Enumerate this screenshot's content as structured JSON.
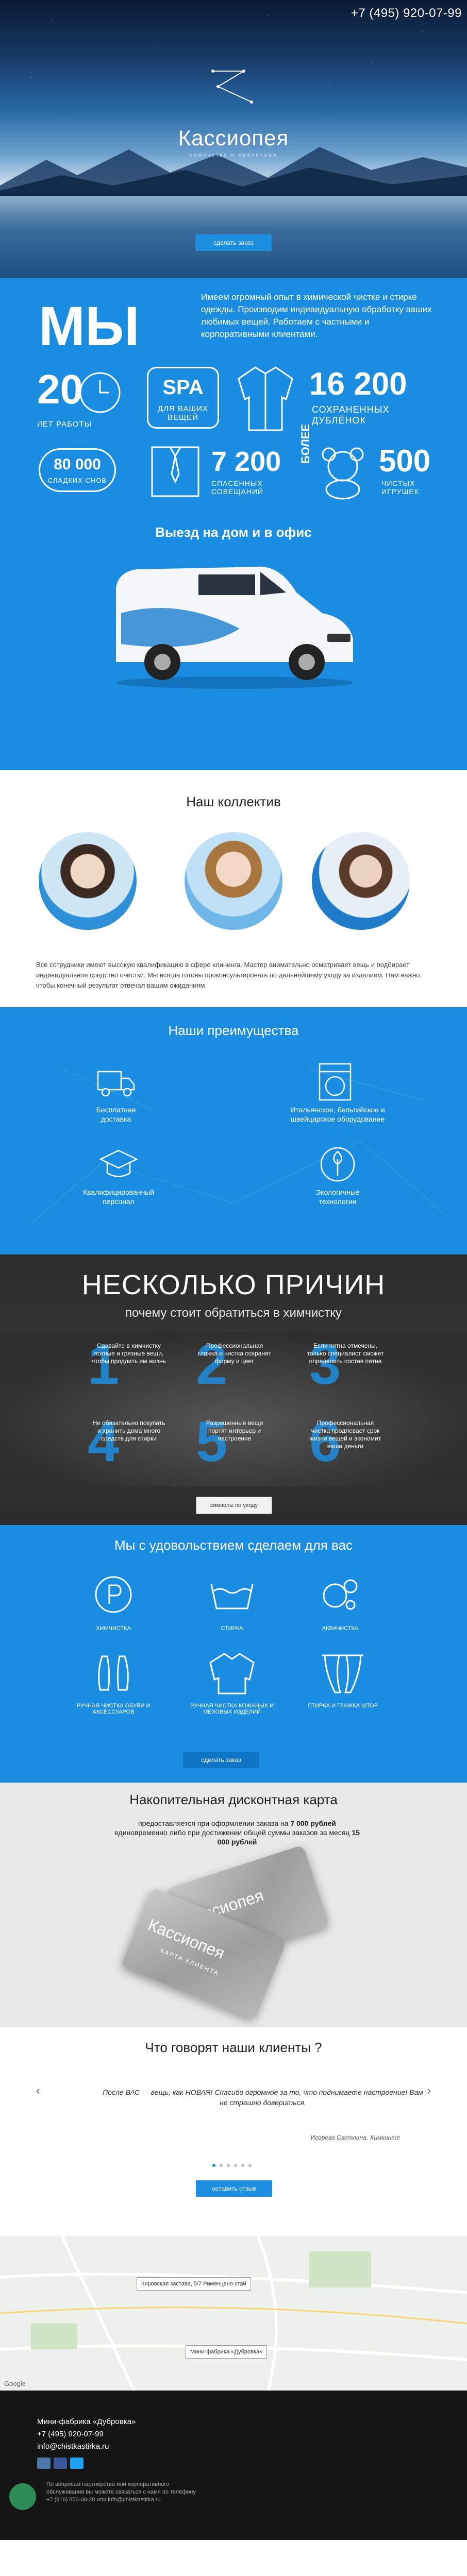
{
  "header": {
    "phone": "+7 (495) 920-07-99"
  },
  "hero": {
    "brand": "Кассиопея",
    "subtitle": "химчистка и прачечная",
    "cta": "сделать заказ"
  },
  "we": {
    "title": "МЫ",
    "about": "Имеем огромный опыт в химической чистке и стирке одежды. Производим индивидуальную обработку ваших любимых вещей. Работаем с частными и корпоративными клиентами.",
    "stats": [
      {
        "num": "20",
        "label": "ЛЕТ РАБОТЫ"
      },
      {
        "num": "SPA",
        "label": "ДЛЯ ВАШИХ ВЕЩЕЙ"
      },
      {
        "num": "16 200",
        "label": "СОХРАНЕННЫХ ДУБЛЁНОК"
      },
      {
        "num": "80 000",
        "label": "СЛАДКИХ СНОВ"
      },
      {
        "num": "7 200",
        "label": "СПАСЕННЫХ СОВЕЩАНИЙ"
      },
      {
        "num": "БОЛЕЕ",
        "label": ""
      },
      {
        "num": "500",
        "label": "ЧИСТЫХ ИГРУШЕК"
      }
    ],
    "delivery": "Выезд на дом и в офис"
  },
  "team": {
    "title": "Наш коллектив",
    "text": "Все сотрудники имеют высокую квалификацию в сфере клининга. Мастер внимательно осматривает вещь и подбирает индивидуальное средство очистки. Мы всегда готовы проконсультировать по дальнейшему уходу за изделием. Нам важно, чтобы конечный результат отвечал вашим ожиданиям."
  },
  "adv": {
    "title": "Наши преимущества",
    "items": [
      "Бесплатная доставка",
      "Итальянское, бельгийское и швейцарское оборудование",
      "Квалифицированный персонал",
      "Экологичные технологии"
    ]
  },
  "reasons": {
    "title": "НЕСКОЛЬКО ПРИЧИН",
    "sub": "почему стоит обратиться в химчистку",
    "items": [
      {
        "n": "1",
        "t": "Сдавайте в химчистку потные и грязные вещи, чтобы продлить им жизнь"
      },
      {
        "n": "2",
        "t": "Профессиональная глажка и чистка сохранят форму и цвет"
      },
      {
        "n": "3",
        "t": "Если пятна отмечены, только специалист сможет определить состав пятна"
      },
      {
        "n": "4",
        "t": "Не обязательно покупать и хранить дома много средств для стирки"
      },
      {
        "n": "5",
        "t": "Разрешенные вещи портят интерьер и настроение"
      },
      {
        "n": "6",
        "t": "Профессиональная чистка продлевает срок жизни вещей и экономит ваши деньги"
      }
    ],
    "btn": "символы по уходу"
  },
  "services": {
    "title": "Мы с удовольствием сделаем для вас",
    "items": [
      "ХИМЧИСТКА",
      "СТИРКА",
      "АКВАЧИСТКА",
      "РУЧНАЯ ЧИСТКА ОБУВИ И АКСЕССУАРОВ",
      "РУЧНАЯ ЧИСТКА КОЖАНЫХ И МЕХОВЫХ ИЗДЕЛИЙ",
      "СТИРКА И ГЛАЖКА ШТОР"
    ],
    "cta": "сделать заказ"
  },
  "card": {
    "title": "Накопительная дисконтная карта",
    "text1": "предоставляется при оформлении заказа на ",
    "sum1": "7 000 рублей",
    "text2": " единовременно либо при достижении общей суммы заказов за месяц ",
    "sum2": "15 000 рублей",
    "brand": "Кассиопея",
    "cardlabel": "КАРТА КЛИЕНТА"
  },
  "reviews": {
    "title": "Что говорят наши клиенты ?",
    "quote": "После ВАС — вещь, как НОВАЯ! Спасибо огромное за то, что поднимаете настроение! Вам не страшно довериться.",
    "author": "Игорева Светлана, Химкинте",
    "btn": "оставить отзыв"
  },
  "map": {
    "pin1": "Кировская застава, 5/7 Рименцено стай",
    "pin2": "Мини-фабрика «Дубровка»",
    "google": "Google"
  },
  "footer": {
    "addr": "Мини-фабрика «Дубровка»",
    "phone": "+7 (495) 920-07-99",
    "email": "info@chistkastirka.ru",
    "note": "По вопросам партнёрства или корпоративного обслуживания вы можете связаться с нами по телефону +7 (916) 850-00-20 или info@chistkastirka.ru"
  }
}
